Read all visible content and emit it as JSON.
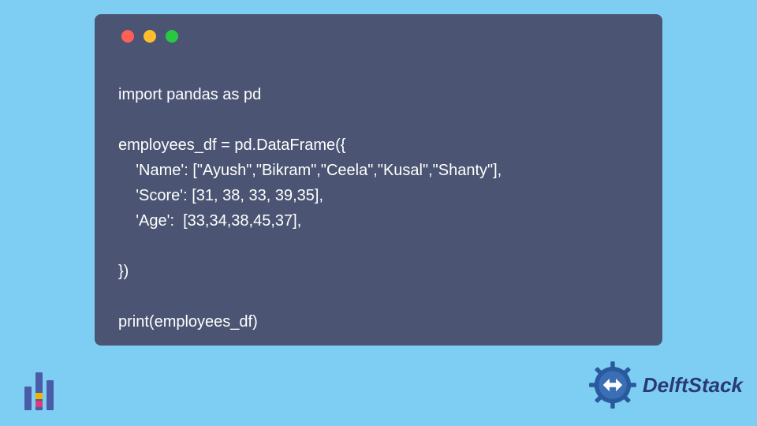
{
  "code": {
    "lines": [
      "import pandas as pd",
      "",
      "employees_df = pd.DataFrame({",
      "    'Name': [\"Ayush\",\"Bikram\",\"Ceela\",\"Kusal\",\"Shanty\"],",
      "    'Score': [31, 38, 33, 39,35],",
      "    'Age':  [33,34,38,45,37],",
      "",
      "})",
      "",
      "print(employees_df)"
    ]
  },
  "brand": {
    "name": "DelftStack"
  },
  "colors": {
    "background": "#7ecef4",
    "code_window": "#4b5573",
    "code_text": "#ffffff",
    "brand_text": "#2a3a76"
  }
}
